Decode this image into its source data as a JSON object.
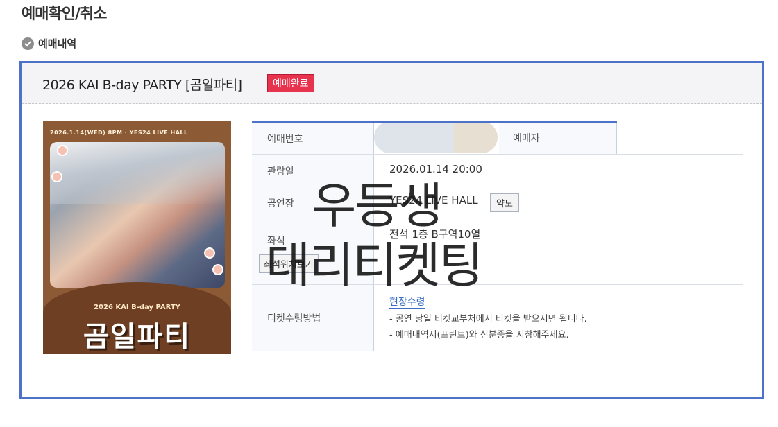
{
  "page": {
    "title": "예매확인/취소",
    "section_label": "예매내역"
  },
  "booking": {
    "performance_title": "2026 KAI B-day PARTY [곰일파티]",
    "status": "예매완료",
    "poster": {
      "top_text": "2026.1.14(WED) 8PM · YES24 LIVE HALL",
      "sub_title": "2026 KAI B-day PARTY",
      "main_title": "곰일파티"
    },
    "fields": {
      "reservation_no_label": "예매번호",
      "buyer_label": "예매자",
      "date_label": "관람일",
      "date_value": "2026.01.14 20:00",
      "venue_label": "공연장",
      "venue_value": "YES24 LIVE HALL",
      "map_button": "약도",
      "seat_label": "좌석",
      "seat_value": "전석 1층 B구역10열",
      "seat_view_button": "좌석위치보기",
      "pickup_label": "티켓수령방법",
      "pickup_method": "현장수령",
      "pickup_notes": [
        "- 공연 당일 티켓교부처에서 티켓을 받으시면 됩니다.",
        "- 예매내역서(프린트)와 신분증을 지참해주세요."
      ]
    }
  },
  "watermark": {
    "line1": "우등생",
    "line2": "대리티켓팅"
  },
  "colors": {
    "card_border": "#4d72c8",
    "status_badge": "#e8334f",
    "link": "#3d6fc4"
  }
}
